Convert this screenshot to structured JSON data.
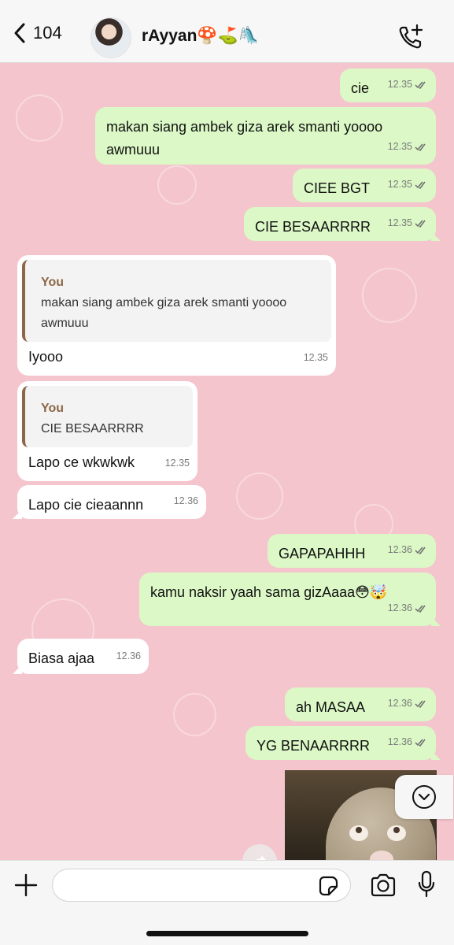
{
  "header": {
    "back_count": "104",
    "contact_name": "rAyyan🍄⛳🛝"
  },
  "messages": [
    {
      "side": "out",
      "text": "cie",
      "time": "12.35"
    },
    {
      "side": "out",
      "text": "makan siang ambek giza arek smanti yoooo awmuuu",
      "time": "12.35"
    },
    {
      "side": "out",
      "text": "CIEE BGT",
      "time": "12.35"
    },
    {
      "side": "out",
      "text": "CIE BESAARRRR",
      "time": "12.35"
    },
    {
      "side": "in",
      "quote_name": "You",
      "quote_text": "makan siang ambek giza arek smanti yoooo awmuuu",
      "text": "Iyooo",
      "time": "12.35"
    },
    {
      "side": "in",
      "quote_name": "You",
      "quote_text": "CIE BESAARRRR",
      "text": "Lapo ce wkwkwk",
      "time": "12.35"
    },
    {
      "side": "in",
      "text": "Lapo cie cieaannn",
      "time": "12.36"
    },
    {
      "side": "out",
      "text": "GAPAPAHHH",
      "time": "12.36"
    },
    {
      "side": "out",
      "text": "kamu naksir yaah sama gizAaaa😳🤯",
      "time": "12.36"
    },
    {
      "side": "in",
      "text": "Biasa ajaa",
      "time": "12.36"
    },
    {
      "side": "out",
      "text": "ah MASAA",
      "time": "12.36"
    },
    {
      "side": "out",
      "text": "YG BENAARRRR",
      "time": "12.36"
    }
  ],
  "composer": {
    "placeholder": ""
  },
  "icons": {
    "back": "chevron-left-icon",
    "call": "add-call-icon",
    "plus": "plus-icon",
    "sticker": "sticker-icon",
    "camera": "camera-icon",
    "mic": "microphone-icon",
    "scroll": "chevron-down-circle-icon",
    "forward": "forward-icon"
  },
  "colors": {
    "chat_bg": "#f5c5cd",
    "outgoing_bubble": "#dbf8c6",
    "incoming_bubble": "#ffffff",
    "quote_accent": "#8d6747"
  }
}
